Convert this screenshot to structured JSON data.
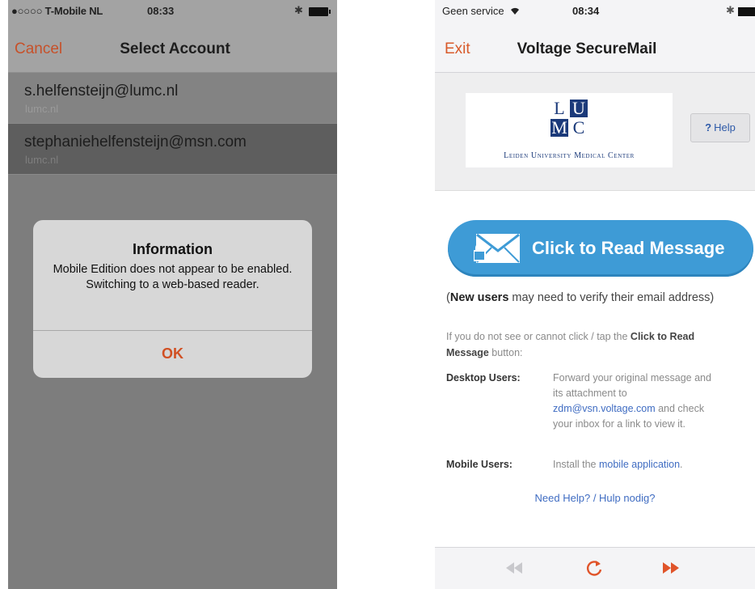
{
  "left_phone": {
    "status": {
      "carrier": "●○○○○ T-Mobile NL",
      "time": "08:33",
      "bluetooth": "✱"
    },
    "nav": {
      "cancel_label": "Cancel",
      "title": "Select Account"
    },
    "accounts": [
      {
        "email": "s.helfensteijn@lumc.nl",
        "subtitle": "lumc.nl"
      },
      {
        "email": "stephaniehelfensteijn@msn.com",
        "subtitle": "lumc.nl"
      }
    ],
    "alert": {
      "title": "Information",
      "message": "Mobile Edition does not appear to be enabled. Switching to a web-based reader.",
      "ok_label": "OK"
    }
  },
  "right_phone": {
    "status": {
      "carrier": "Geen service",
      "time": "08:34",
      "bluetooth": "✱"
    },
    "nav": {
      "exit_label": "Exit",
      "title": "Voltage SecureMail"
    },
    "logo": {
      "letters": [
        "L",
        "U",
        "M",
        "C"
      ],
      "name": "Leiden University Medical Center"
    },
    "help": {
      "icon": "?",
      "label": "Help"
    },
    "read_button": {
      "label": "Click to Read Message",
      "icon": "envelope-lock-icon"
    },
    "new_users": {
      "bold": "New users",
      "rest": " may need to verify their email address)",
      "open": "("
    },
    "info": {
      "pre": "If you do not see or cannot click / tap the ",
      "bold1": "Click to Read",
      "bold2": "Message",
      "post": " button:"
    },
    "desktop": {
      "label": "Desktop Users:",
      "line1": "Forward your original message and",
      "line2": "its attachment to",
      "email": "zdm@vsn.voltage.com",
      "after_email": " and check",
      "line4": "your inbox for a link to view it."
    },
    "mobile": {
      "label": "Mobile Users:",
      "pre": "Install the ",
      "link": "mobile application",
      "post": "."
    },
    "need_help": "Need Help? / Hulp nodig?",
    "toolbar": {
      "back": "◀◀",
      "reload": "↻",
      "forward": "▶▶"
    },
    "colors": {
      "accent": "#d85a2a",
      "button": "#3e9bd6",
      "logo_blue": "#1b3a7a",
      "link": "#3f6cc2"
    }
  }
}
